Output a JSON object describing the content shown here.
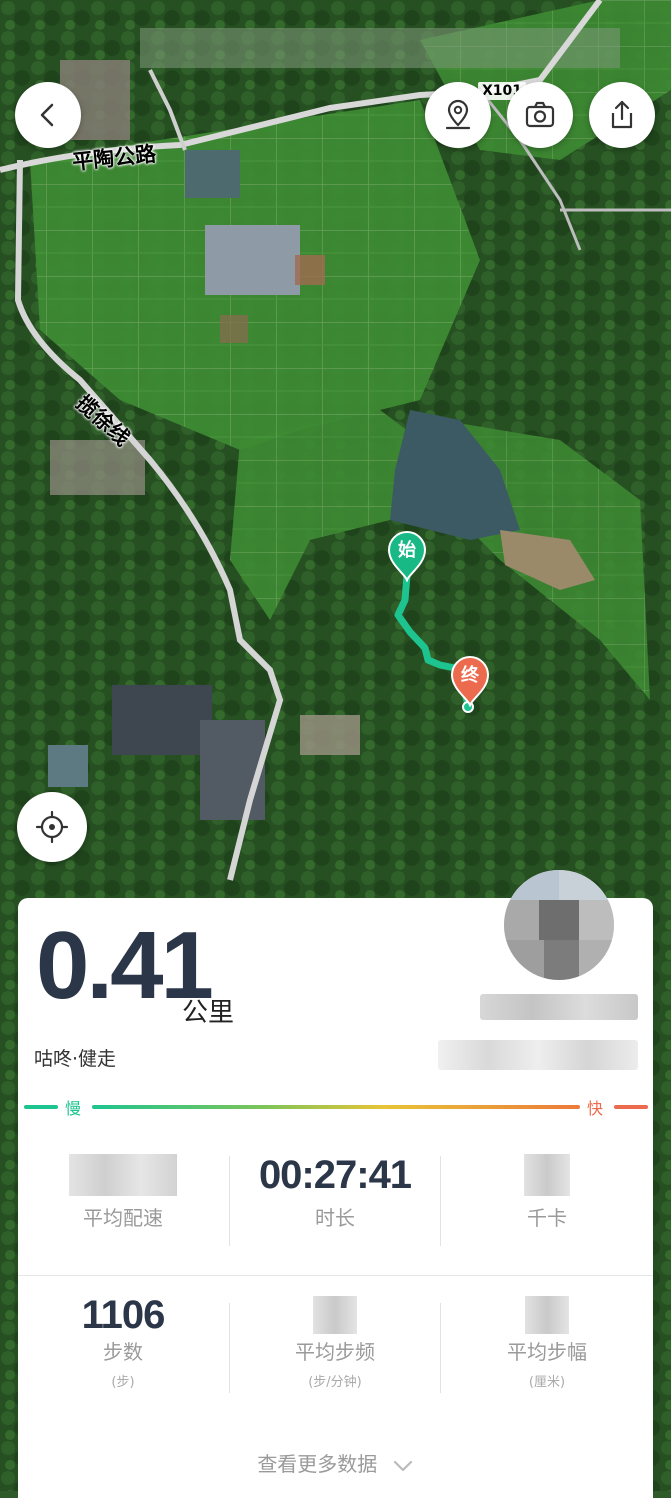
{
  "map": {
    "roads": [
      {
        "name": "平陶公路"
      },
      {
        "name": "揽徐线"
      },
      {
        "name": "X101"
      }
    ],
    "route": {
      "start_label": "始",
      "end_label": "终",
      "color": "#1dc48f",
      "start_color": "#18b985",
      "end_color": "#ec6a4e"
    },
    "controls": {
      "back_icon": "chevron-left-icon",
      "location_icon": "map-pin-icon",
      "camera_icon": "camera-icon",
      "share_icon": "share-icon",
      "locate_icon": "crosshair-icon"
    }
  },
  "summary": {
    "distance": "0.41",
    "distance_unit": "公里",
    "activity": "咕咚·健走"
  },
  "speed_scale": {
    "slow": "慢",
    "fast": "快"
  },
  "stats": [
    {
      "value": "",
      "label": "平均配速",
      "unit": ""
    },
    {
      "value": "00:27:41",
      "label": "时长",
      "unit": ""
    },
    {
      "value": "",
      "label": "千卡",
      "unit": ""
    },
    {
      "value": "1106",
      "label": "步数",
      "unit": "(步)"
    },
    {
      "value": "",
      "label": "平均步频",
      "unit": "(步/分钟)"
    },
    {
      "value": "",
      "label": "平均步幅",
      "unit": "(厘米)"
    }
  ],
  "more_data": "查看更多数据",
  "colors": {
    "accent_green": "#1ec48f",
    "accent_red": "#ec6a4e",
    "text_dark": "#2b3648"
  }
}
